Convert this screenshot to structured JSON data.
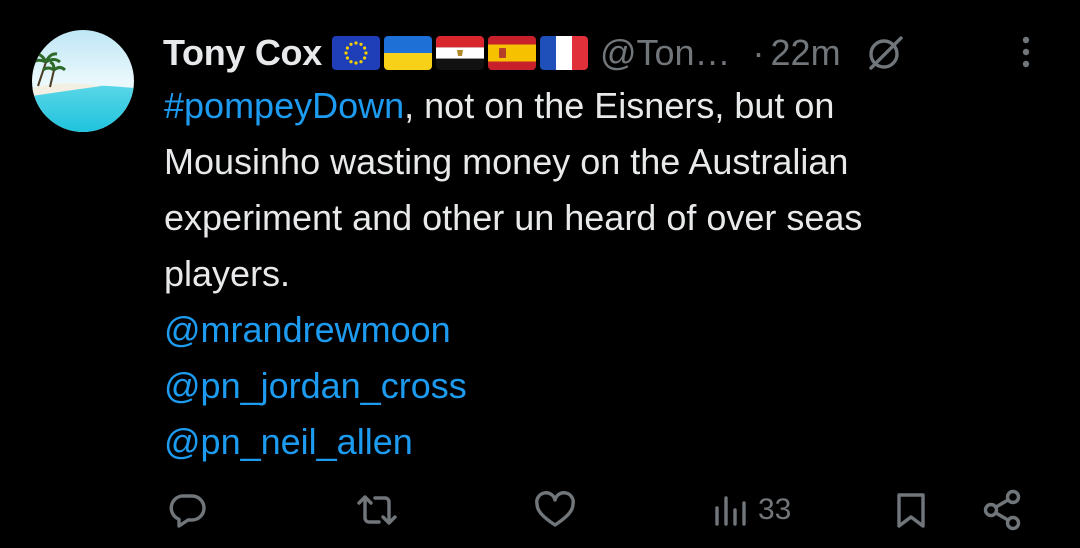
{
  "tweet": {
    "author": {
      "display_name": "Tony Cox",
      "handle": "@Ton…",
      "avatar_icon": "beach-avatar",
      "flags": [
        "eu-flag",
        "ukraine-flag",
        "egypt-flag",
        "spain-flag",
        "france-flag"
      ]
    },
    "separator": "·",
    "time": "22m",
    "grok_icon": "slashed-circle-icon",
    "more_icon": "vertical-dots-icon",
    "body": {
      "hashtag": "#pompeyDown",
      "line1_rest": ", not on the Eisners, but on",
      "line2": "Mousinho wasting money on the Australian",
      "line3": "experiment and other un heard of over seas",
      "line4": "players.",
      "mentions": [
        "@mrandrewmoon",
        "@pn_jordan_cross",
        "@pn_neil_allen"
      ]
    },
    "actions": {
      "reply_icon": "reply-icon",
      "retweet_icon": "retweet-icon",
      "like_icon": "heart-icon",
      "views_icon": "views-chart-icon",
      "views_count": "33",
      "bookmark_icon": "bookmark-icon",
      "share_icon": "share-icon"
    }
  },
  "colors": {
    "background": "#000000",
    "text": "#e7e9ea",
    "secondary": "#71767b",
    "link": "#1d9bf0"
  }
}
